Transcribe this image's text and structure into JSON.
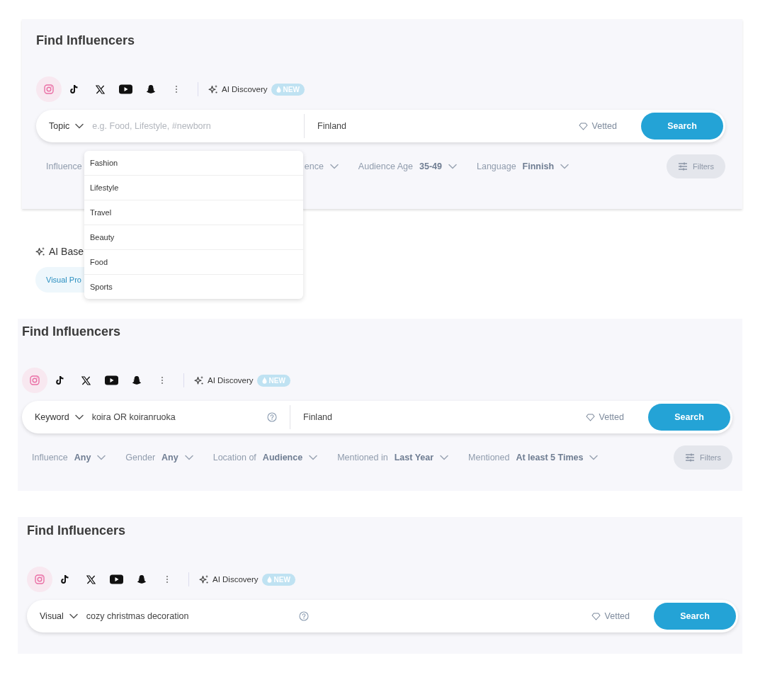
{
  "panels": [
    {
      "title": "Find Influencers",
      "platforms": [
        {
          "kind": "instagram",
          "selected": true
        },
        {
          "kind": "tiktok",
          "selected": false
        },
        {
          "kind": "x",
          "selected": false
        },
        {
          "kind": "youtube",
          "selected": false
        },
        {
          "kind": "snapchat",
          "selected": false
        },
        {
          "kind": "more",
          "selected": false
        }
      ],
      "ai_discovery": {
        "label": "AI Discovery",
        "badge": "NEW"
      },
      "search": {
        "mode": "Topic",
        "placeholder": "e.g. Food, Lifestyle, #newborn",
        "help": false,
        "location": "Finland",
        "vetted": "Vetted",
        "button": "Search"
      },
      "mode_menu": [
        "Fashion",
        "Lifestyle",
        "Travel",
        "Beauty",
        "Food",
        "Sports"
      ],
      "filters": [
        {
          "text": "Influence",
          "chevron": false
        },
        {
          "text": "ence",
          "chevron": true
        },
        {
          "text": "Audience Age **35-49**",
          "chevron": true
        },
        {
          "text": "Language **Finnish**",
          "chevron": true
        }
      ],
      "filters_button": "Filters",
      "ai_section": {
        "title": "AI Base",
        "chip": "Visual Pro"
      }
    },
    {
      "title": "Find Influencers",
      "platforms": [
        {
          "kind": "instagram",
          "selected": true
        },
        {
          "kind": "tiktok",
          "selected": false
        },
        {
          "kind": "x",
          "selected": false
        },
        {
          "kind": "youtube",
          "selected": false
        },
        {
          "kind": "snapchat",
          "selected": false
        },
        {
          "kind": "more",
          "selected": false
        }
      ],
      "ai_discovery": {
        "label": "AI Discovery",
        "badge": "NEW"
      },
      "search": {
        "mode": "Keyword",
        "value": "koira OR koiranruoka",
        "help": true,
        "location": "Finland",
        "vetted": "Vetted",
        "button": "Search"
      },
      "filters": [
        {
          "text": "Influence **Any**",
          "chevron": true
        },
        {
          "text": "Gender **Any**",
          "chevron": true
        },
        {
          "text": "Location of **Audience**",
          "chevron": true
        },
        {
          "text": "Mentioned in **Last Year**",
          "chevron": true
        },
        {
          "text": "Mentioned **At least 5 Times**",
          "chevron": true
        }
      ],
      "filters_button": "Filters"
    },
    {
      "title": "Find Influencers",
      "platforms": [
        {
          "kind": "instagram",
          "selected": true
        },
        {
          "kind": "tiktok",
          "selected": false
        },
        {
          "kind": "x",
          "selected": false
        },
        {
          "kind": "youtube",
          "selected": false
        },
        {
          "kind": "snapchat",
          "selected": false
        },
        {
          "kind": "more",
          "selected": false
        }
      ],
      "ai_discovery": {
        "label": "AI Discovery",
        "badge": "NEW"
      },
      "search": {
        "mode": "Visual",
        "value": "cozy christmas decoration",
        "help": true,
        "vetted": "Vetted",
        "button": "Search"
      }
    }
  ]
}
